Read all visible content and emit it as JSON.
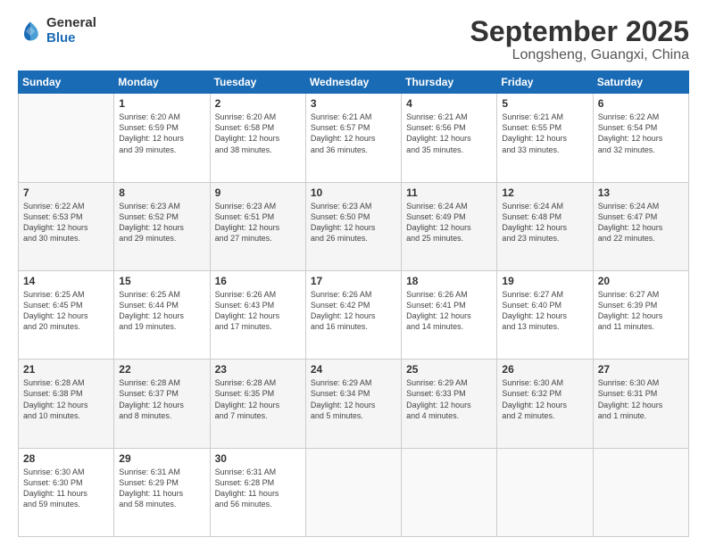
{
  "logo": {
    "general": "General",
    "blue": "Blue"
  },
  "header": {
    "month": "September 2025",
    "location": "Longsheng, Guangxi, China"
  },
  "weekdays": [
    "Sunday",
    "Monday",
    "Tuesday",
    "Wednesday",
    "Thursday",
    "Friday",
    "Saturday"
  ],
  "weeks": [
    [
      {
        "day": "",
        "content": ""
      },
      {
        "day": "1",
        "content": "Sunrise: 6:20 AM\nSunset: 6:59 PM\nDaylight: 12 hours\nand 39 minutes."
      },
      {
        "day": "2",
        "content": "Sunrise: 6:20 AM\nSunset: 6:58 PM\nDaylight: 12 hours\nand 38 minutes."
      },
      {
        "day": "3",
        "content": "Sunrise: 6:21 AM\nSunset: 6:57 PM\nDaylight: 12 hours\nand 36 minutes."
      },
      {
        "day": "4",
        "content": "Sunrise: 6:21 AM\nSunset: 6:56 PM\nDaylight: 12 hours\nand 35 minutes."
      },
      {
        "day": "5",
        "content": "Sunrise: 6:21 AM\nSunset: 6:55 PM\nDaylight: 12 hours\nand 33 minutes."
      },
      {
        "day": "6",
        "content": "Sunrise: 6:22 AM\nSunset: 6:54 PM\nDaylight: 12 hours\nand 32 minutes."
      }
    ],
    [
      {
        "day": "7",
        "content": "Sunrise: 6:22 AM\nSunset: 6:53 PM\nDaylight: 12 hours\nand 30 minutes."
      },
      {
        "day": "8",
        "content": "Sunrise: 6:23 AM\nSunset: 6:52 PM\nDaylight: 12 hours\nand 29 minutes."
      },
      {
        "day": "9",
        "content": "Sunrise: 6:23 AM\nSunset: 6:51 PM\nDaylight: 12 hours\nand 27 minutes."
      },
      {
        "day": "10",
        "content": "Sunrise: 6:23 AM\nSunset: 6:50 PM\nDaylight: 12 hours\nand 26 minutes."
      },
      {
        "day": "11",
        "content": "Sunrise: 6:24 AM\nSunset: 6:49 PM\nDaylight: 12 hours\nand 25 minutes."
      },
      {
        "day": "12",
        "content": "Sunrise: 6:24 AM\nSunset: 6:48 PM\nDaylight: 12 hours\nand 23 minutes."
      },
      {
        "day": "13",
        "content": "Sunrise: 6:24 AM\nSunset: 6:47 PM\nDaylight: 12 hours\nand 22 minutes."
      }
    ],
    [
      {
        "day": "14",
        "content": "Sunrise: 6:25 AM\nSunset: 6:45 PM\nDaylight: 12 hours\nand 20 minutes."
      },
      {
        "day": "15",
        "content": "Sunrise: 6:25 AM\nSunset: 6:44 PM\nDaylight: 12 hours\nand 19 minutes."
      },
      {
        "day": "16",
        "content": "Sunrise: 6:26 AM\nSunset: 6:43 PM\nDaylight: 12 hours\nand 17 minutes."
      },
      {
        "day": "17",
        "content": "Sunrise: 6:26 AM\nSunset: 6:42 PM\nDaylight: 12 hours\nand 16 minutes."
      },
      {
        "day": "18",
        "content": "Sunrise: 6:26 AM\nSunset: 6:41 PM\nDaylight: 12 hours\nand 14 minutes."
      },
      {
        "day": "19",
        "content": "Sunrise: 6:27 AM\nSunset: 6:40 PM\nDaylight: 12 hours\nand 13 minutes."
      },
      {
        "day": "20",
        "content": "Sunrise: 6:27 AM\nSunset: 6:39 PM\nDaylight: 12 hours\nand 11 minutes."
      }
    ],
    [
      {
        "day": "21",
        "content": "Sunrise: 6:28 AM\nSunset: 6:38 PM\nDaylight: 12 hours\nand 10 minutes."
      },
      {
        "day": "22",
        "content": "Sunrise: 6:28 AM\nSunset: 6:37 PM\nDaylight: 12 hours\nand 8 minutes."
      },
      {
        "day": "23",
        "content": "Sunrise: 6:28 AM\nSunset: 6:35 PM\nDaylight: 12 hours\nand 7 minutes."
      },
      {
        "day": "24",
        "content": "Sunrise: 6:29 AM\nSunset: 6:34 PM\nDaylight: 12 hours\nand 5 minutes."
      },
      {
        "day": "25",
        "content": "Sunrise: 6:29 AM\nSunset: 6:33 PM\nDaylight: 12 hours\nand 4 minutes."
      },
      {
        "day": "26",
        "content": "Sunrise: 6:30 AM\nSunset: 6:32 PM\nDaylight: 12 hours\nand 2 minutes."
      },
      {
        "day": "27",
        "content": "Sunrise: 6:30 AM\nSunset: 6:31 PM\nDaylight: 12 hours\nand 1 minute."
      }
    ],
    [
      {
        "day": "28",
        "content": "Sunrise: 6:30 AM\nSunset: 6:30 PM\nDaylight: 11 hours\nand 59 minutes."
      },
      {
        "day": "29",
        "content": "Sunrise: 6:31 AM\nSunset: 6:29 PM\nDaylight: 11 hours\nand 58 minutes."
      },
      {
        "day": "30",
        "content": "Sunrise: 6:31 AM\nSunset: 6:28 PM\nDaylight: 11 hours\nand 56 minutes."
      },
      {
        "day": "",
        "content": ""
      },
      {
        "day": "",
        "content": ""
      },
      {
        "day": "",
        "content": ""
      },
      {
        "day": "",
        "content": ""
      }
    ]
  ]
}
